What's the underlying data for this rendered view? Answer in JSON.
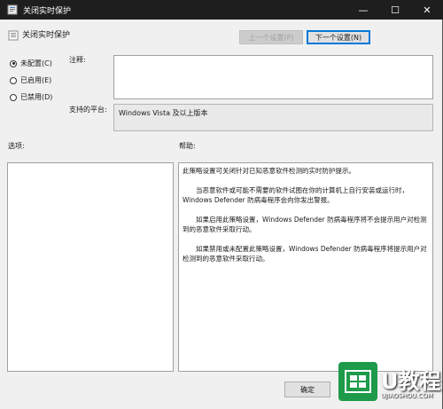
{
  "window": {
    "title": "关闭实时保护",
    "controls": {
      "minimize": "—",
      "maximize": "☐",
      "close": "✕"
    }
  },
  "header": {
    "policy_title": "关闭实时保护",
    "prev_button": "上一个设置(P)",
    "next_button": "下一个设置(N)"
  },
  "state": {
    "options": [
      {
        "label": "未配置(C)",
        "checked": true
      },
      {
        "label": "已启用(E)",
        "checked": false
      },
      {
        "label": "已禁用(D)",
        "checked": false
      }
    ]
  },
  "comment": {
    "label": "注释:",
    "value": ""
  },
  "platform": {
    "label": "支持的平台:",
    "value": "Windows Vista 及以上版本"
  },
  "sections": {
    "options_label": "选项:",
    "help_label": "帮助:"
  },
  "help": {
    "paragraphs": [
      "此策略设置可关闭针对已知恶意软件检测的实时防护提示。",
      "当恶意软件或可能不需要的软件试图在你的计算机上自行安装或运行时，Windows Defender 防病毒程序会向你发出警报。",
      "如果启用此策略设置，Windows Defender 防病毒程序将不会提示用户对检测到的恶意软件采取行动。",
      "如果禁用或未配置此策略设置，Windows Defender 防病毒程序将提示用户对检测到的恶意软件采取行动。"
    ]
  },
  "footer": {
    "ok_button": "确定"
  },
  "watermark": {
    "brand": "U教程",
    "url": "UJIAOSHOU.COM"
  },
  "colors": {
    "titlebar": "#1e1e1e",
    "window_bg": "#f0f0f0",
    "watermark_green": "#1d9a4a",
    "accent_blue": "#0078d7"
  }
}
